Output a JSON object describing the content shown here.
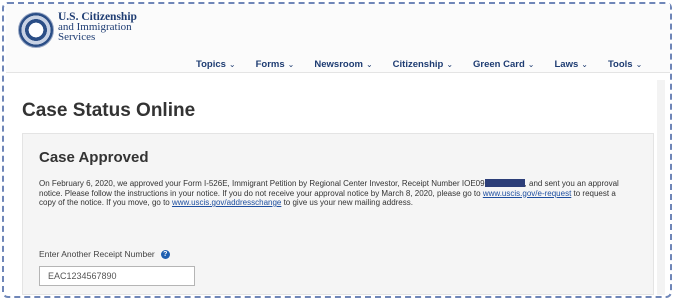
{
  "header": {
    "logo": {
      "line1": "U.S. Citizenship",
      "line2": "and Immigration",
      "line3": "Services"
    },
    "nav": [
      {
        "label": "Topics"
      },
      {
        "label": "Forms"
      },
      {
        "label": "Newsroom"
      },
      {
        "label": "Citizenship"
      },
      {
        "label": "Green Card"
      },
      {
        "label": "Laws"
      },
      {
        "label": "Tools"
      }
    ]
  },
  "main": {
    "page_title": "Case Status Online",
    "status_title": "Case Approved",
    "message": {
      "p1": "On February 6, 2020, we approved your Form I-526E, Immigrant Petition by Regional Center Investor, Receipt Number IOE09",
      "p2": ", and sent you an approval notice. Please follow the instructions in your notice. If you do not receive your approval notice by March 8, 2020, please go to ",
      "link1": "www.uscis.gov/e-request",
      "p3": " to request a copy of the notice. If you move, go to ",
      "link2": "www.uscis.gov/addresschange",
      "p4": " to give us your new mailing address."
    },
    "receipt": {
      "label": "Enter Another Receipt Number",
      "value": "EAC1234567890"
    }
  },
  "colors": {
    "brand": "#1e3c72",
    "link": "#1e4fa0",
    "redaction": "#2c3e78"
  }
}
